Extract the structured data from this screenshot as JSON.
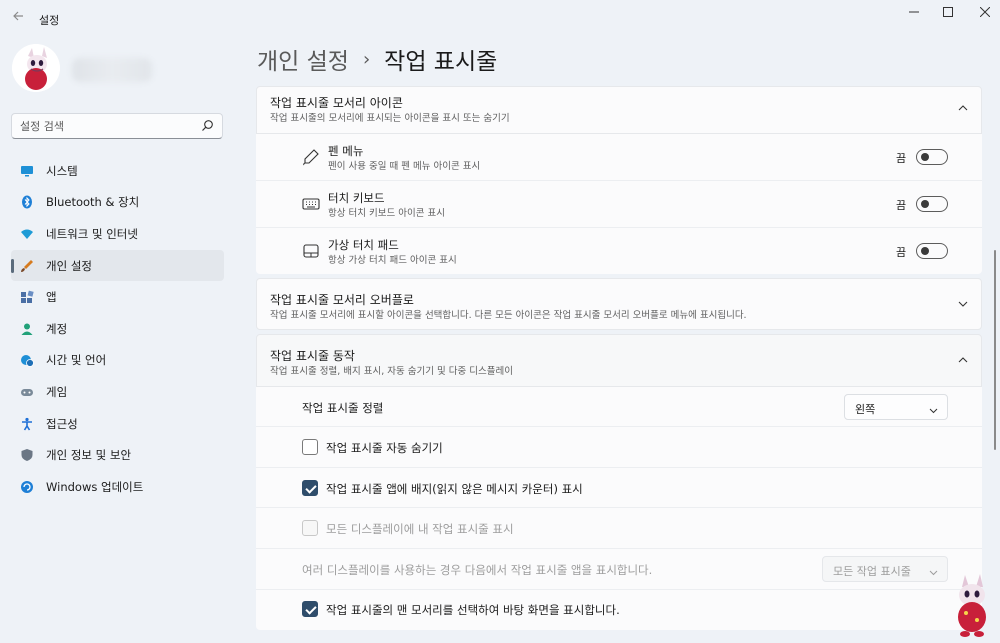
{
  "window": {
    "title": "설정",
    "back_icon": "back-arrow-icon",
    "controls": {
      "minimize": "—",
      "maximize": "☐",
      "close": "✕"
    }
  },
  "sidebar": {
    "search": {
      "placeholder": "설정 검색"
    },
    "items": [
      {
        "label": "시스템",
        "icon": "monitor-icon",
        "color": "#1e90d6"
      },
      {
        "label": "Bluetooth & 장치",
        "icon": "bluetooth-icon",
        "color": "#1e7fd6"
      },
      {
        "label": "네트워크 및 인터넷",
        "icon": "wifi-icon",
        "color": "#1e9bd6"
      },
      {
        "label": "개인 설정",
        "icon": "brush-icon",
        "color": "#d67b1e",
        "selected": true
      },
      {
        "label": "앱",
        "icon": "apps-icon",
        "color": "#4a6fa5"
      },
      {
        "label": "계정",
        "icon": "person-icon",
        "color": "#21a179"
      },
      {
        "label": "시간 및 언어",
        "icon": "globe-clock-icon",
        "color": "#1e8fd6"
      },
      {
        "label": "게임",
        "icon": "gamepad-icon",
        "color": "#7a8a99"
      },
      {
        "label": "접근성",
        "icon": "accessibility-icon",
        "color": "#1e6fd6"
      },
      {
        "label": "개인 정보 및 보안",
        "icon": "shield-icon",
        "color": "#6b7785"
      },
      {
        "label": "Windows 업데이트",
        "icon": "update-icon",
        "color": "#1e7fd6"
      }
    ]
  },
  "breadcrumb": {
    "parent": "개인 설정",
    "separator": "›",
    "current": "작업 표시줄"
  },
  "corner_icons_section": {
    "title": "작업 표시줄 모서리 아이콘",
    "subtitle": "작업 표시줄의 모서리에 표시되는 아이콘을 표시 또는 숨기기",
    "items": [
      {
        "title": "펜 메뉴",
        "subtitle": "펜이 사용 중일 때 펜 메뉴 아이콘 표시",
        "state": "끔",
        "icon": "pen-icon"
      },
      {
        "title": "터치 키보드",
        "subtitle": "항상 터치 키보드 아이콘 표시",
        "state": "끔",
        "icon": "keyboard-icon"
      },
      {
        "title": "가상 터치 패드",
        "subtitle": "항상 가상 터치 패드 아이콘 표시",
        "state": "끔",
        "icon": "touchpad-icon"
      }
    ]
  },
  "overflow_section": {
    "title": "작업 표시줄 모서리 오버플로",
    "subtitle": "작업 표시줄 모서리에 표시할 아이콘을 선택합니다. 다른 모든 아이콘은 작업 표시줄 모서리 오버플로 메뉴에 표시됩니다."
  },
  "behavior_section": {
    "title": "작업 표시줄 동작",
    "subtitle": "작업 표시줄 정렬, 배지 표시, 자동 숨기기 및 다중 디스플레이",
    "alignment": {
      "label": "작업 표시줄 정렬",
      "value": "왼쪽"
    },
    "auto_hide": {
      "label": "작업 표시줄 자동 숨기기",
      "checked": false
    },
    "badges": {
      "label": "작업 표시줄 앱에 배지(읽지 않은 메시지 카운터) 표시",
      "checked": true
    },
    "all_displays": {
      "label": "모든 디스플레이에 내 작업 표시줄 표시",
      "checked": false,
      "disabled": true
    },
    "multi_display": {
      "label": "여러 디스플레이를 사용하는 경우 다음에서 작업 표시줄 앱을 표시합니다.",
      "value": "모든 작업 표시줄",
      "disabled": true
    },
    "desktop_corner": {
      "label": "작업 표시줄의 맨 모서리를 선택하여 바탕 화면을 표시합니다.",
      "checked": true
    }
  },
  "colors": {
    "accent": "#2f4d6b",
    "background": "#eef2f7",
    "card": "#fbfbfc"
  }
}
